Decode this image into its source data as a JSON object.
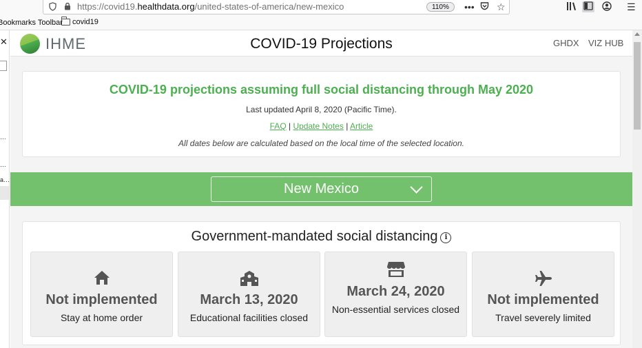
{
  "browser": {
    "url_prefix": "https://covid19.",
    "url_domain": "healthdata.org",
    "url_path": "/united-states-of-america/new-mexico",
    "zoom": "110%",
    "bookmarks_toolbar_label": "Bookmarks Toolbar",
    "bookmark_folder": "covid19"
  },
  "header": {
    "logo_text": "IHME",
    "title": "COVID-19 Projections",
    "nav": [
      "GHDX",
      "VIZ HUB"
    ]
  },
  "update": {
    "heading": "COVID-19 projections assuming full social distancing through May 2020",
    "last_updated": "Last updated April 8, 2020 (Pacific Time).",
    "links": [
      "FAQ",
      "Update Notes",
      "Article"
    ],
    "separator": "|",
    "note": "All dates below are calculated based on the local time of the selected location."
  },
  "location": {
    "selected": "New Mexico"
  },
  "social_distancing": {
    "heading": "Government-mandated social distancing",
    "tiles": [
      {
        "icon": "home-icon",
        "value": "Not implemented",
        "label": "Stay at home order"
      },
      {
        "icon": "school-icon",
        "value": "March 13, 2020",
        "label": "Educational facilities closed"
      },
      {
        "icon": "store-icon",
        "value": "March 24, 2020",
        "label": "Non-essential services closed"
      },
      {
        "icon": "airplane-icon",
        "value": "Not implemented",
        "label": "Travel severely limited"
      }
    ]
  },
  "colors": {
    "accent_green": "#4caf50",
    "band_green": "#73c16c"
  }
}
